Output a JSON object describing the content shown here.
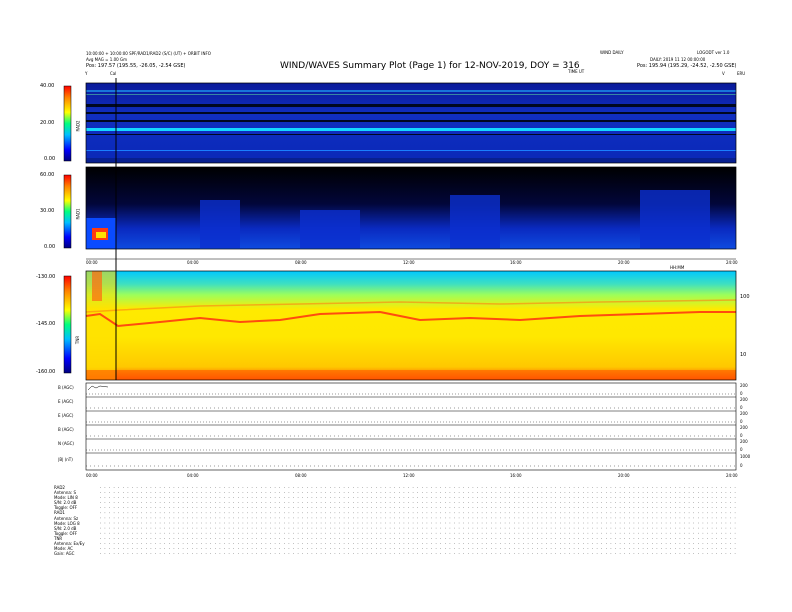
{
  "header": {
    "title": "WIND/WAVES Summary Plot (Page 1) for 12-NOV-2019, DOY = 316",
    "left_line1": "10:00:00 + 10:00:00 SPF/RAD1/RAD2 (S/C) (UT) + ORBIT INFO",
    "left_line2": "Avg MAG = 1.00 Gm",
    "left_pos": "Pos: 197.57 (195.55, -26.05, -2.54 GSE)",
    "right_line1": "WIND DAILY",
    "right_line2": "DAILY: 2019 11 12 00:00:00",
    "right_pos": "Pos: 195.94 (195.29, -24.52, -2.50 GSE)",
    "top_right_code": "LOGODT ver 1.0",
    "center_code": "TIME UT",
    "cal_label": "Cal",
    "left_tick": "Y",
    "right_tick": "V",
    "right_sym": "ERU"
  },
  "panels": {
    "rad2": {
      "label": "RAD2",
      "ticks": [
        "40.00",
        "20.00",
        "0.00"
      ]
    },
    "rad1": {
      "label": "RAD1",
      "ticks": [
        "60.00",
        "30.00",
        "0.00"
      ]
    },
    "tnr": {
      "label": "TNR",
      "ticks": [
        "-130.00",
        "-145.00",
        "-160.00"
      ],
      "right_ticks": [
        "100",
        "10"
      ]
    },
    "time_ticks": [
      "00:00",
      "04:00",
      "08:00",
      "12:00",
      "16:00",
      "20:00",
      "24:00"
    ],
    "time_unit": "HH:MM"
  },
  "mag_panels": [
    {
      "label": "B (AGC)",
      "right": [
        "200",
        "0"
      ]
    },
    {
      "label": "E (AGC)",
      "right": [
        "200",
        "0"
      ]
    },
    {
      "label": "E (AGC)",
      "right": [
        "200",
        "0"
      ]
    },
    {
      "label": "B (AGC)",
      "right": [
        "200",
        "0"
      ]
    },
    {
      "label": "N (AGC)",
      "right": [
        "200",
        "0"
      ]
    },
    {
      "label": "|B| (nT)",
      "right": [
        "1000",
        "0"
      ]
    }
  ],
  "stats": {
    "rad2_title": "RAD2",
    "rad2_rows": [
      "Antenna: S",
      "Mode: LIN 8",
      "S/N: 2.0 dB",
      "Toggle: OFF"
    ],
    "rad1_title": "RAD1",
    "rad1_rows": [
      "Antenna: Sz",
      "Mode: LOG 8",
      "S/N: 2.0 dB",
      "Toggle: OFF"
    ],
    "tnr_title": "TNR",
    "tnr_rows": [
      "Antenna: Ex/Ey",
      "Mode: AC",
      "Gain: AGC"
    ]
  },
  "chart_data": {
    "type": "heatmap",
    "title": "WIND/WAVES Summary Plot (Page 1) for 12-NOV-2019, DOY = 316",
    "xlabel": "HH:MM",
    "xlim": [
      "00:00",
      "24:00"
    ],
    "panels": [
      "RAD2",
      "RAD1",
      "TNR"
    ],
    "rad2_ylim": [
      0,
      40
    ],
    "rad1_ylim": [
      0,
      60
    ],
    "tnr_ylim": [
      -160,
      -130
    ],
    "colors": {
      "low": "#00007f",
      "mid": "#00ff7f",
      "high": "#ff0000"
    }
  }
}
